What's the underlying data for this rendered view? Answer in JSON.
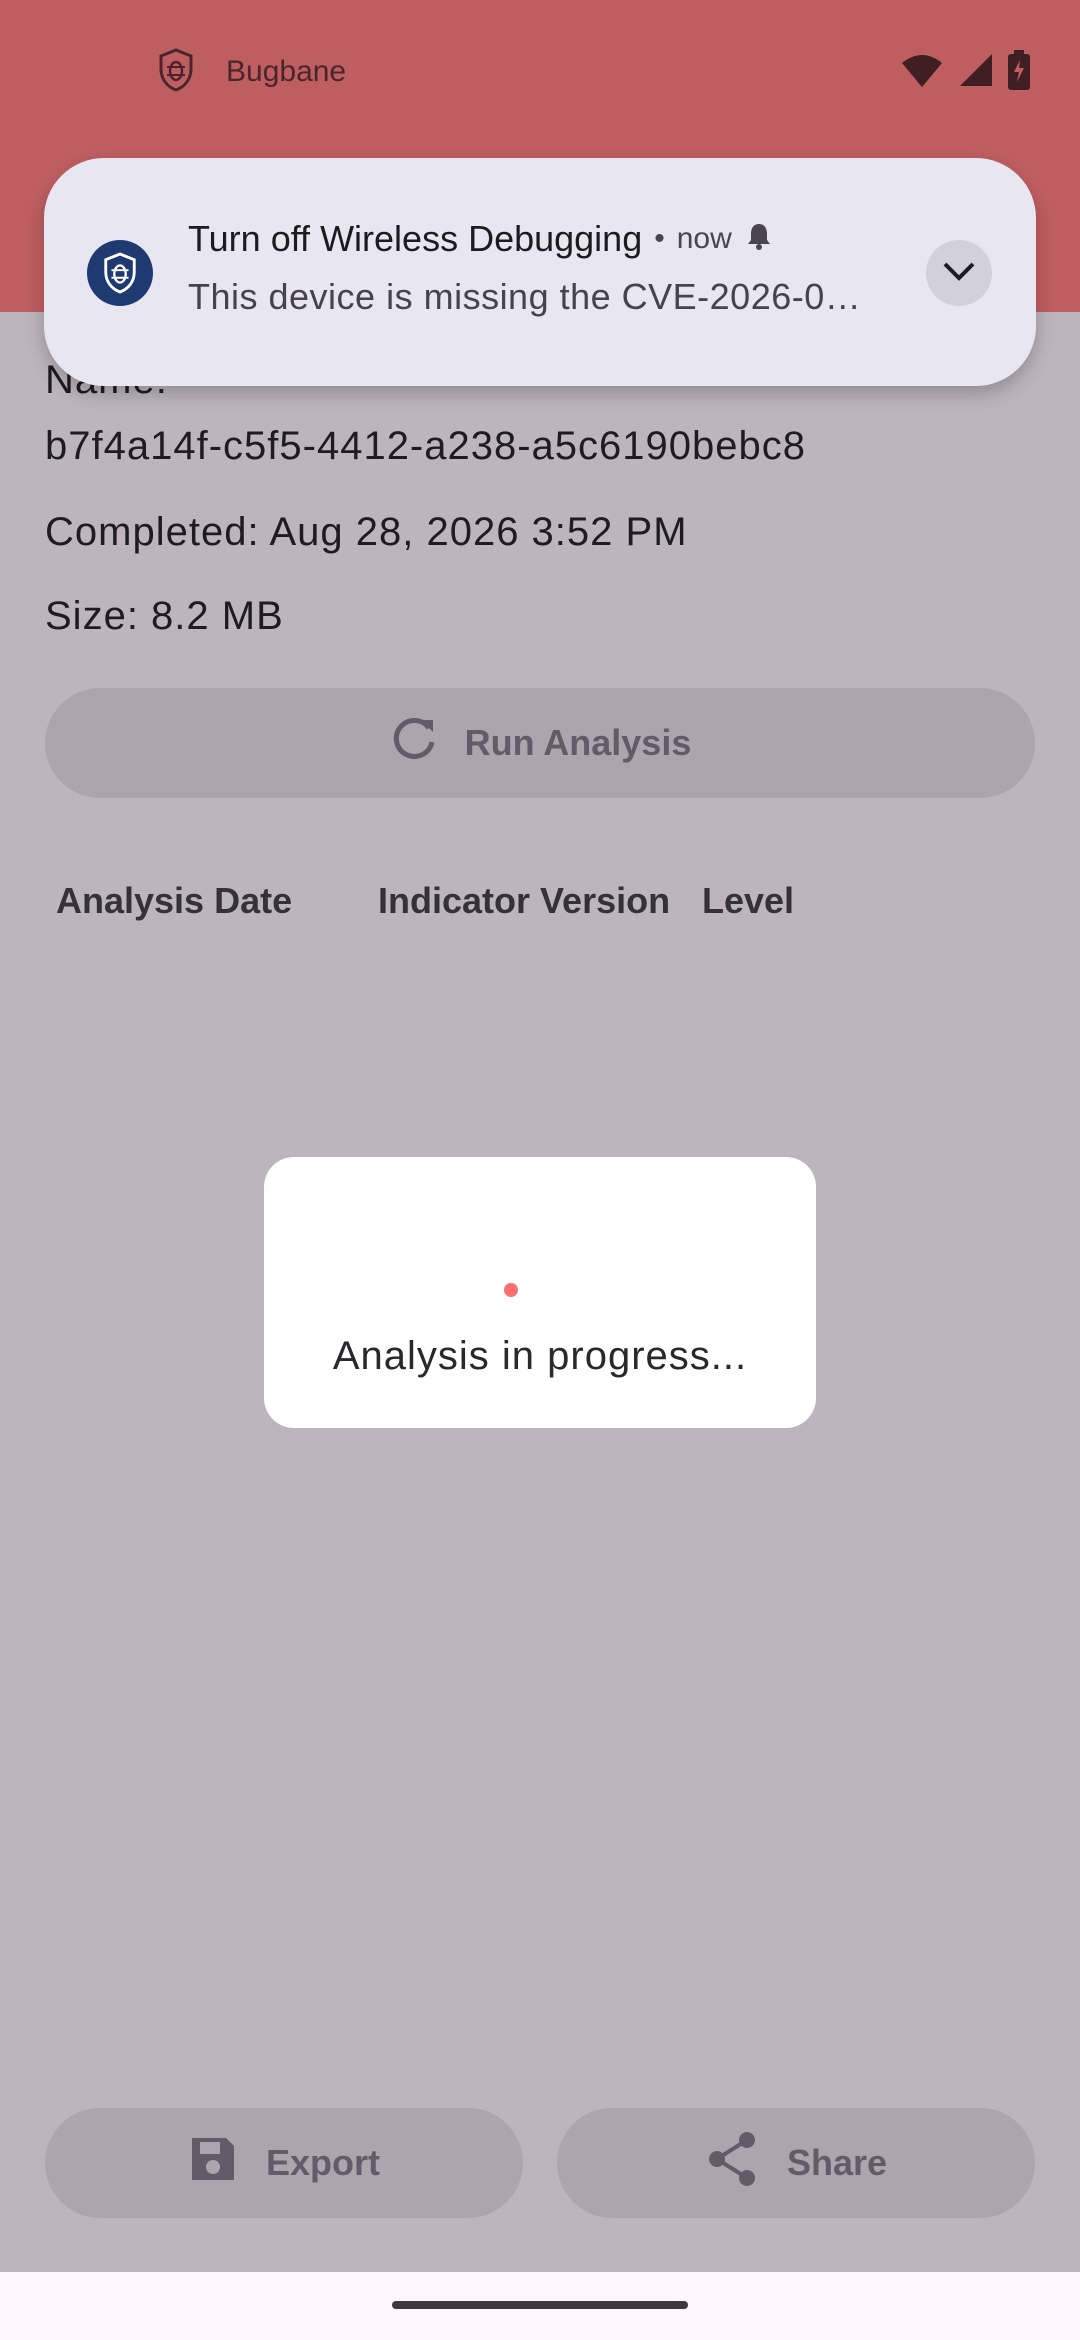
{
  "app": {
    "title": "Bugbane",
    "header_color": "#ff7a78"
  },
  "details": {
    "name_label": "Name:",
    "name_value": "b7f4a14f-c5f5-4412-a238-a5c6190bebc8",
    "completed": "Completed: Aug 28, 2026 3:52 PM",
    "size": "Size: 8.2 MB"
  },
  "actions": {
    "run_analysis": "Run Analysis",
    "export": "Export",
    "share": "Share"
  },
  "table": {
    "headers": [
      "Analysis Date",
      "Indicator Version",
      "Level"
    ]
  },
  "dialog": {
    "message": "Analysis in progress..."
  },
  "notification": {
    "title": "Turn off Wireless Debugging",
    "separator": "•",
    "time": "now",
    "body": "This device is missing the CVE-2026-0…"
  },
  "icons": {
    "app": "bug-shield-icon",
    "wifi": "wifi-icon",
    "signal": "cell-signal-icon",
    "battery": "battery-charging-icon",
    "refresh": "refresh-icon",
    "save": "save-icon",
    "share": "share-icon",
    "bell": "bell-alert-icon",
    "expand": "chevron-down-icon"
  }
}
